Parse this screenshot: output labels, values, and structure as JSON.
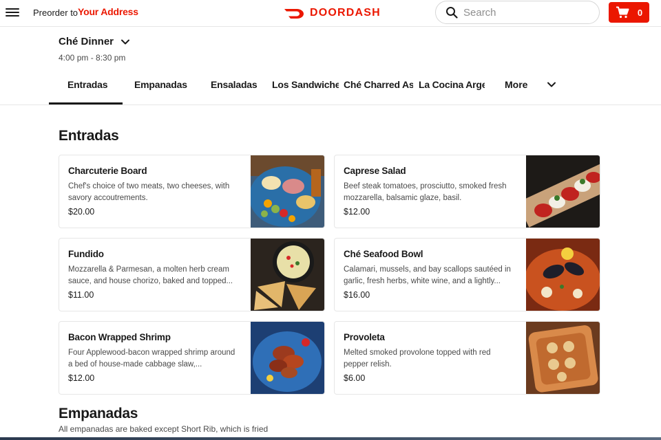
{
  "header": {
    "preorder_label": "Preorder to",
    "address": "Your Address",
    "logo_text": "DOORDASH",
    "search_placeholder": "Search",
    "cart_count": "0",
    "brand_color": "#eb1700"
  },
  "menu": {
    "name": "Ché Dinner",
    "hours": "4:00 pm - 8:30 pm"
  },
  "tabs": [
    {
      "label": "Entradas",
      "active": true
    },
    {
      "label": "Empanadas"
    },
    {
      "label": "Ensaladas"
    },
    {
      "label": "Los Sandwiches"
    },
    {
      "label": "Ché Charred Asado"
    },
    {
      "label": "La Cocina Argentina"
    }
  ],
  "more_label": "More",
  "sections": [
    {
      "title": "Entradas",
      "items": [
        {
          "name": "Charcuterie Board",
          "desc": "Chef's choice of two meats, two cheeses, with savory accoutrements.",
          "price": "$20.00"
        },
        {
          "name": "Caprese Salad",
          "desc": "Beef steak tomatoes, prosciutto, smoked fresh mozzarella, balsamic glaze, basil.",
          "price": "$12.00"
        },
        {
          "name": "Fundido",
          "desc": "Mozzarella & Parmesan, a molten herb cream sauce, and house chorizo, baked and topped...",
          "price": "$11.00"
        },
        {
          "name": "Ché Seafood Bowl",
          "desc": "Calamari, mussels, and bay scallops sautéed in garlic, fresh herbs, white wine, and a lightly...",
          "price": "$16.00"
        },
        {
          "name": "Bacon Wrapped Shrimp",
          "desc": "Four Applewood-bacon wrapped shrimp around a bed of house-made cabbage slaw,...",
          "price": "$12.00"
        },
        {
          "name": "Provoleta",
          "desc": "Melted smoked provolone topped with red pepper relish.",
          "price": "$6.00"
        }
      ]
    },
    {
      "title": "Empanadas",
      "subtitle": "All empanadas are baked except Short Rib, which is fried"
    }
  ],
  "icons": {
    "menu": "hamburger-menu-icon",
    "search": "search-icon",
    "cart": "cart-icon",
    "chevron": "chevron-down-icon"
  }
}
